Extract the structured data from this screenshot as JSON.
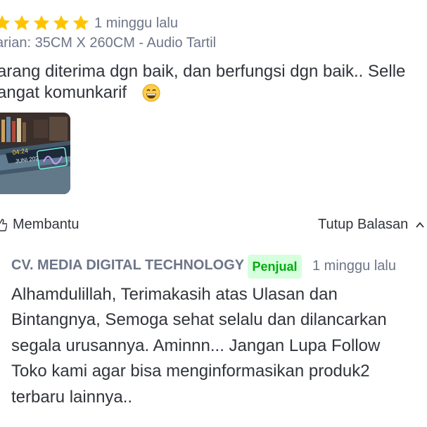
{
  "review": {
    "rating": 5,
    "time_ago": "1 minggu lalu",
    "variant": "arian: 35CM X 260CM - Audio Tartil",
    "text_lines": [
      "arang diterima dgn baik, dan berfungsi dgn baik.. Selle",
      "angat komunkarif"
    ],
    "emoji_icon": "grinning-face-icon",
    "photo_icon": "review-photo-thumbnail",
    "helpful_label": "Membantu",
    "close_reply_label": "Tutup Balasan"
  },
  "seller_reply": {
    "name": "CV. MEDIA DIGITAL TECHNOLOGY",
    "badge": "Penjual",
    "time_ago": "1 minggu lalu",
    "text_lines": [
      "Alhamdulillah, Terimakasih atas Ulasan dan",
      "Bintangnya, Semoga sehat selalu dan dilancarkan",
      "segala urusannya. Aminnn... Jangan Lupa Follow",
      "Toko kami agar bisa menginformasikan produk2",
      "terbaru lainnya.."
    ]
  },
  "colors": {
    "star": "#ffc400",
    "text_primary": "#31353b",
    "text_secondary": "#6d7588",
    "badge_bg": "#d6ffde",
    "badge_text": "#03ac0e"
  }
}
